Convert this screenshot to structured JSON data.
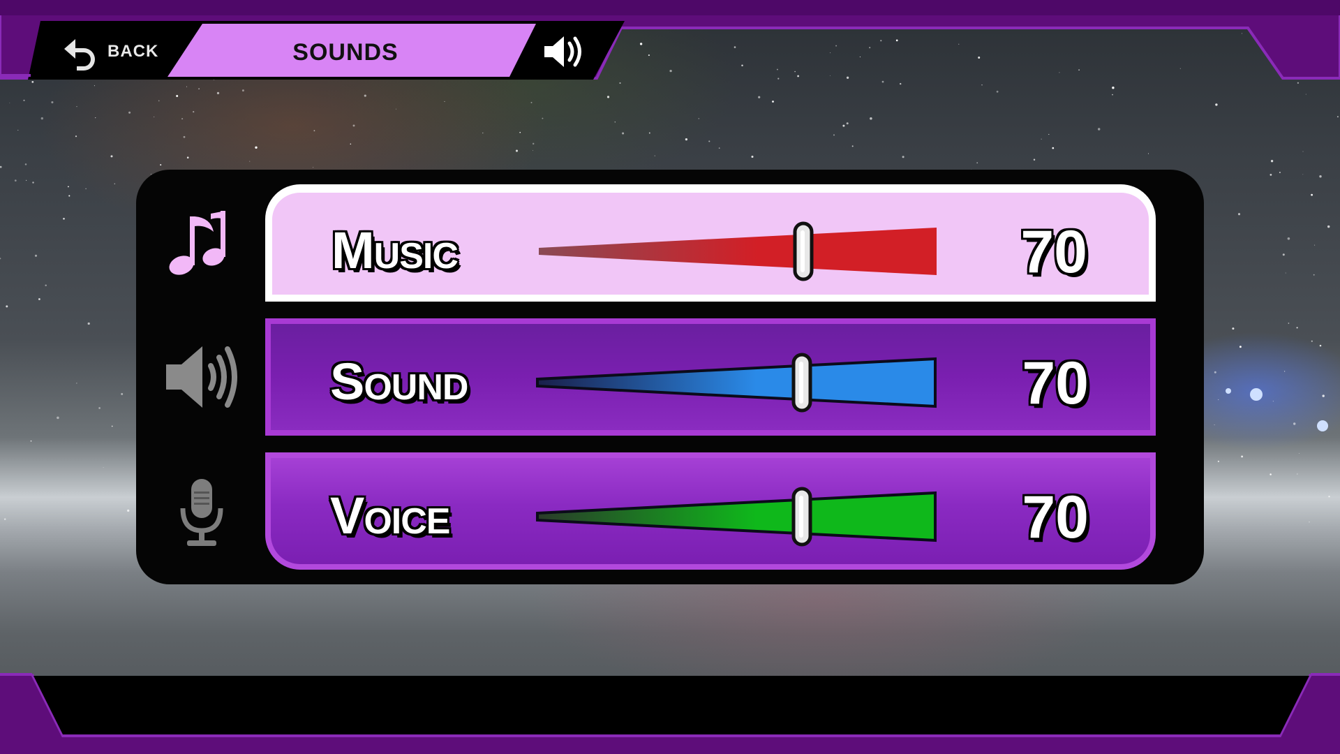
{
  "header": {
    "back_label": "BACK",
    "title": "SOUNDS",
    "icon": "speaker-icon"
  },
  "colors": {
    "frame_purple": "#5e0d7a",
    "frame_edge": "#8a2bb8",
    "header_tab": "#d884f5",
    "music_bar": "#d21f26",
    "sound_bar": "#2a8ae8",
    "voice_bar": "#0fb81b"
  },
  "settings": [
    {
      "id": "music",
      "label": "Music",
      "value": "70",
      "level": 0.7,
      "icon": "music-note-icon",
      "selected": true
    },
    {
      "id": "sound",
      "label": "Sound",
      "value": "70",
      "level": 0.7,
      "icon": "speaker-icon",
      "selected": false
    },
    {
      "id": "voice",
      "label": "Voice",
      "value": "70",
      "level": 0.7,
      "icon": "microphone-icon",
      "selected": false
    }
  ]
}
